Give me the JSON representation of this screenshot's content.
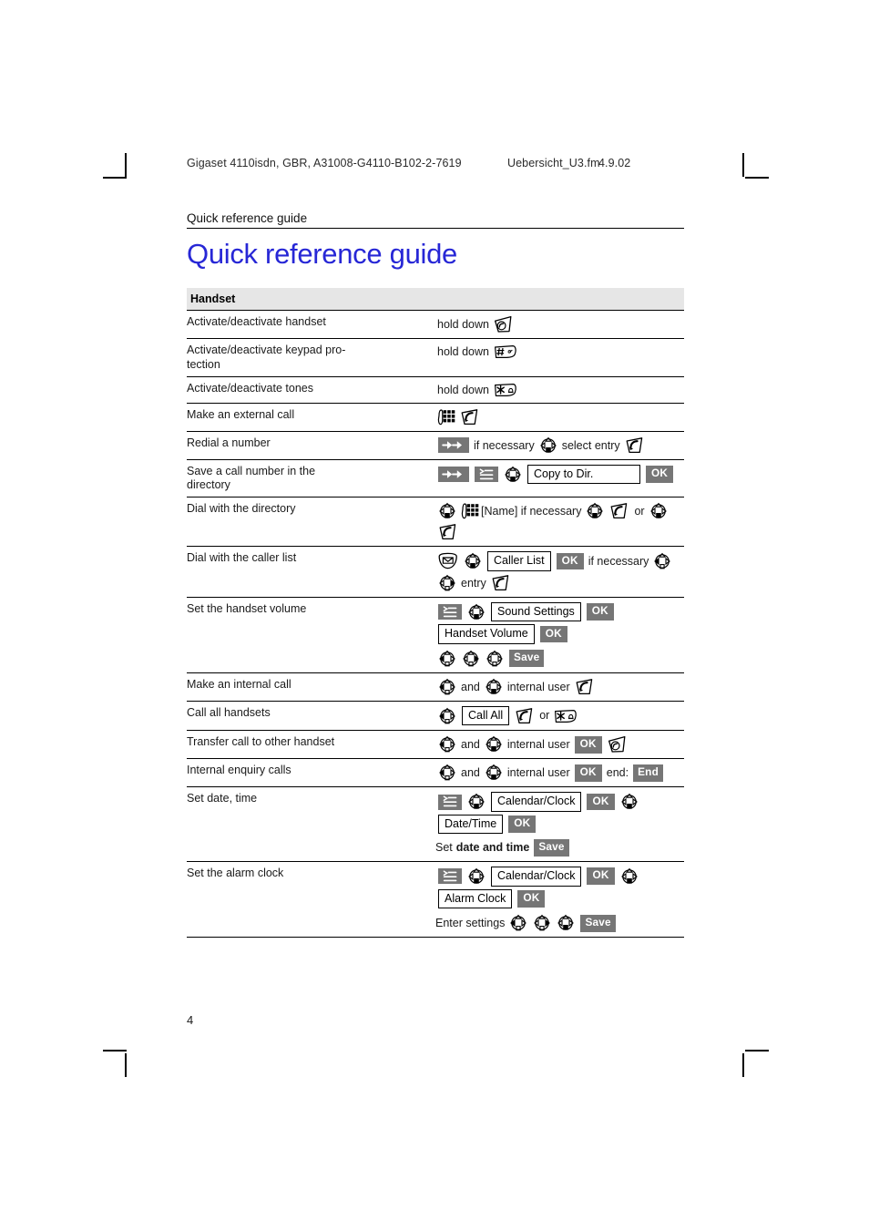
{
  "running_head": {
    "doc_id": "Gigaset 4110isdn, GBR, A31008-G4110-B102-2-7619",
    "fm_name": "Uebersicht_U3.fm",
    "fm_date": "4.9.02"
  },
  "section_label": "Quick reference guide",
  "title": "Quick reference guide",
  "colors": {
    "title_blue": "#2727d6",
    "header_row_gray": "#e6e6e6",
    "chip_gray": "#767676"
  },
  "table": {
    "header": "Handset",
    "rows": [
      {
        "label": "Activate/deactivate handset",
        "steps": [
          {
            "kind": "text",
            "text": "hold down"
          },
          {
            "kind": "icon",
            "icon": "hangup-key-icon"
          }
        ]
      },
      {
        "label": "Activate/deactivate keypad pro-tection",
        "label_line1": "Activate/deactivate keypad pro-",
        "label_line2": "tection",
        "steps": [
          {
            "kind": "text",
            "text": "hold down"
          },
          {
            "kind": "icon",
            "icon": "hash-key-icon"
          }
        ]
      },
      {
        "label": "Activate/deactivate tones",
        "steps": [
          {
            "kind": "text",
            "text": "hold down"
          },
          {
            "kind": "icon",
            "icon": "star-key-icon"
          }
        ]
      },
      {
        "label": "Make an external call",
        "steps": [
          {
            "kind": "icon",
            "icon": "keypad-icon"
          },
          {
            "kind": "icon",
            "icon": "talk-key-icon"
          }
        ]
      },
      {
        "label": "Redial a number",
        "steps": [
          {
            "kind": "icon",
            "icon": "redial-key-icon"
          },
          {
            "kind": "text",
            "text": "if necessary"
          },
          {
            "kind": "icon",
            "icon": "nav-key-icon"
          },
          {
            "kind": "text",
            "text": "select entry"
          },
          {
            "kind": "icon",
            "icon": "talk-key-icon"
          }
        ]
      },
      {
        "label": "Save a call number in the directory",
        "label_line1": "Save a call number in the",
        "label_line2": "directory",
        "steps": [
          {
            "kind": "icon",
            "icon": "redial-key-icon"
          },
          {
            "kind": "icon",
            "icon": "menu-key-icon"
          },
          {
            "kind": "icon",
            "icon": "nav-key-icon"
          },
          {
            "kind": "display",
            "text": "Copy to Dir.",
            "width": 124
          },
          {
            "kind": "chip",
            "text": "OK"
          }
        ]
      },
      {
        "label": "Dial with the directory",
        "steps": [
          {
            "kind": "icon",
            "icon": "nav-key-icon"
          },
          {
            "kind": "icon",
            "icon": "keypad-icon"
          },
          {
            "kind": "text",
            "text": "[Name] if necessary",
            "tight": true
          },
          {
            "kind": "icon",
            "icon": "nav-key-icon"
          },
          {
            "kind": "icon",
            "icon": "talk-key-icon"
          },
          {
            "kind": "text",
            "text": "or"
          },
          {
            "kind": "icon",
            "icon": "nav-key-icon"
          },
          {
            "kind": "icon",
            "icon": "talk-key-icon"
          }
        ]
      },
      {
        "label": "Dial with the caller list",
        "steps": [
          {
            "kind": "icon",
            "icon": "envelope-key-icon"
          },
          {
            "kind": "icon",
            "icon": "nav-key-icon"
          },
          {
            "kind": "display",
            "text": "Caller List"
          },
          {
            "kind": "chip",
            "text": "OK"
          },
          {
            "kind": "text",
            "text": "if necessary"
          },
          {
            "kind": "icon",
            "icon": "nav-key-left-icon"
          },
          {
            "kind": "icon",
            "icon": "nav-key-right-icon"
          },
          {
            "kind": "text",
            "text": "entry"
          },
          {
            "kind": "icon",
            "icon": "talk-key-icon"
          }
        ]
      },
      {
        "label": "Set the handset volume",
        "steps": [
          {
            "kind": "icon",
            "icon": "menu-key-icon"
          },
          {
            "kind": "icon",
            "icon": "nav-key-icon"
          },
          {
            "kind": "display",
            "text": "Sound Settings"
          },
          {
            "kind": "chip",
            "text": "OK"
          },
          {
            "kind": "display",
            "text": "Handset Volume"
          },
          {
            "kind": "chip",
            "text": "OK"
          },
          {
            "kind": "break"
          },
          {
            "kind": "icon",
            "icon": "nav-key-left-icon"
          },
          {
            "kind": "icon",
            "icon": "nav-key-right-icon"
          },
          {
            "kind": "icon",
            "icon": "nav-key-down-open-icon"
          },
          {
            "kind": "chip",
            "text": "Save"
          }
        ]
      },
      {
        "label": "Make an internal call",
        "steps": [
          {
            "kind": "icon",
            "icon": "nav-key-left-icon"
          },
          {
            "kind": "text",
            "text": "and"
          },
          {
            "kind": "icon",
            "icon": "nav-key-icon"
          },
          {
            "kind": "text",
            "text": "internal user"
          },
          {
            "kind": "icon",
            "icon": "talk-key-icon"
          }
        ]
      },
      {
        "label": "Call all handsets",
        "steps": [
          {
            "kind": "icon",
            "icon": "nav-key-left-icon"
          },
          {
            "kind": "display",
            "text": "Call All"
          },
          {
            "kind": "icon",
            "icon": "talk-key-icon"
          },
          {
            "kind": "text",
            "text": "or"
          },
          {
            "kind": "icon",
            "icon": "star-key-icon"
          }
        ]
      },
      {
        "label": "Transfer call to other handset",
        "steps": [
          {
            "kind": "icon",
            "icon": "nav-key-left-icon"
          },
          {
            "kind": "text",
            "text": "and"
          },
          {
            "kind": "icon",
            "icon": "nav-key-icon"
          },
          {
            "kind": "text",
            "text": "internal user"
          },
          {
            "kind": "chip",
            "text": "OK"
          },
          {
            "kind": "icon",
            "icon": "hangup-key-icon"
          }
        ]
      },
      {
        "label": "Internal enquiry calls",
        "steps": [
          {
            "kind": "icon",
            "icon": "nav-key-left-icon"
          },
          {
            "kind": "text",
            "text": "and"
          },
          {
            "kind": "icon",
            "icon": "nav-key-icon"
          },
          {
            "kind": "text",
            "text": "internal user"
          },
          {
            "kind": "chip",
            "text": "OK"
          },
          {
            "kind": "text",
            "text": "end:"
          },
          {
            "kind": "chip",
            "text": "End"
          }
        ]
      },
      {
        "label": "Set date, time",
        "steps": [
          {
            "kind": "icon",
            "icon": "menu-key-icon"
          },
          {
            "kind": "icon",
            "icon": "nav-key-icon"
          },
          {
            "kind": "display",
            "text": "Calendar/Clock"
          },
          {
            "kind": "chip",
            "text": "OK"
          },
          {
            "kind": "icon",
            "icon": "nav-key-icon"
          },
          {
            "kind": "display",
            "text": "Date/Time"
          },
          {
            "kind": "chip",
            "text": "OK"
          },
          {
            "kind": "break"
          },
          {
            "kind": "text",
            "text": "Set",
            "tight": true
          },
          {
            "kind": "bold",
            "text": "date and time"
          },
          {
            "kind": "chip",
            "text": "Save"
          }
        ]
      },
      {
        "label": "Set the alarm clock",
        "steps": [
          {
            "kind": "icon",
            "icon": "menu-key-icon"
          },
          {
            "kind": "icon",
            "icon": "nav-key-icon"
          },
          {
            "kind": "display",
            "text": "Calendar/Clock"
          },
          {
            "kind": "chip",
            "text": "OK"
          },
          {
            "kind": "icon",
            "icon": "nav-key-icon"
          },
          {
            "kind": "display",
            "text": "Alarm Clock"
          },
          {
            "kind": "chip",
            "text": "OK"
          },
          {
            "kind": "break"
          },
          {
            "kind": "text",
            "text": "Enter settings",
            "tight": true
          },
          {
            "kind": "icon",
            "icon": "nav-key-left-icon"
          },
          {
            "kind": "icon",
            "icon": "nav-key-right-icon"
          },
          {
            "kind": "icon",
            "icon": "nav-key-icon"
          },
          {
            "kind": "chip",
            "text": "Save"
          }
        ]
      }
    ]
  },
  "page_number": "4"
}
